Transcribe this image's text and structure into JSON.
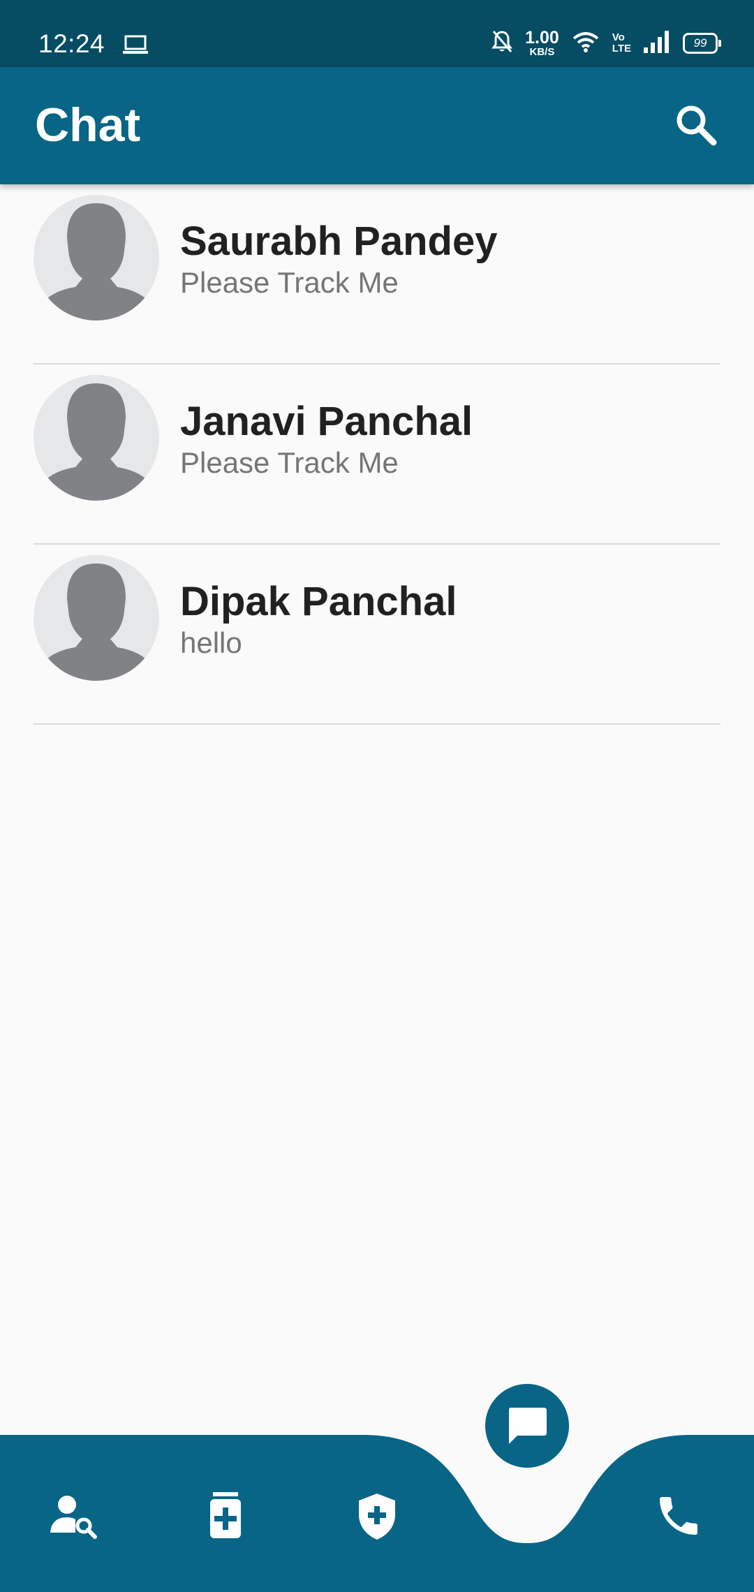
{
  "status_bar": {
    "time": "12:24",
    "net_speed_value": "1.00",
    "net_speed_unit": "KB/S",
    "volte_top": "Vo",
    "volte_bottom": "LTE",
    "battery": "99"
  },
  "app_bar": {
    "title": "Chat"
  },
  "chats": [
    {
      "name": "Saurabh Pandey",
      "last_message": "Please Track Me"
    },
    {
      "name": "Janavi Panchal",
      "last_message": "Please Track Me"
    },
    {
      "name": "Dipak Panchal",
      "last_message": "hello"
    }
  ],
  "bottom_nav": {
    "items": [
      "find-person",
      "medical-records",
      "health-shield",
      "chat",
      "phone"
    ],
    "active": "chat"
  },
  "colors": {
    "status_bar": "#064c63",
    "primary": "#086585",
    "background": "#fafafa",
    "name_text": "#212121",
    "message_text": "#757575",
    "avatar_bg": "#e6e7e8",
    "avatar_fg": "#808285"
  }
}
